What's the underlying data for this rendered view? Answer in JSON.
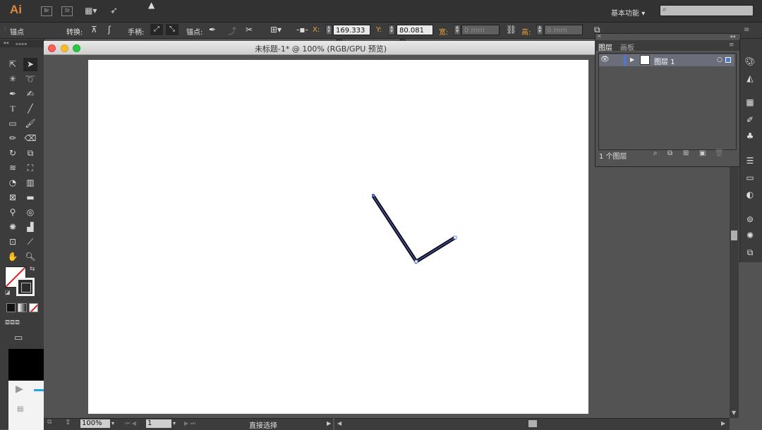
{
  "app": {
    "logo": "Ai",
    "bridge_label": "Br",
    "stock_label": "St",
    "workspace": "基本功能",
    "search": {
      "placeholder": ""
    }
  },
  "control_bar": {
    "section": "锚点",
    "convert_label": "转换:",
    "handles_label": "手柄:",
    "anchor_label": "锚点:",
    "x_label": "X:",
    "x_value": "169.333 m",
    "y_label": "Y:",
    "y_value": "80.081 m",
    "width_label": "宽:",
    "width_value": "0 mm",
    "height_label": "高:",
    "height_value": "0 mm"
  },
  "document": {
    "title": "未标题-1* @ 100% (RGB/GPU 预览)"
  },
  "status": {
    "zoom": "100%",
    "artboard": "1",
    "tool_text": "直接选择"
  },
  "layers_panel": {
    "tabs": [
      "图层",
      "画板"
    ],
    "layer_name": "图层 1",
    "layer_count": "1 个图层"
  },
  "colors": {
    "accent_layer": "#4a78d9",
    "path_stroke": "#0f0f23",
    "selection_anchor": "#4a6fe0"
  }
}
